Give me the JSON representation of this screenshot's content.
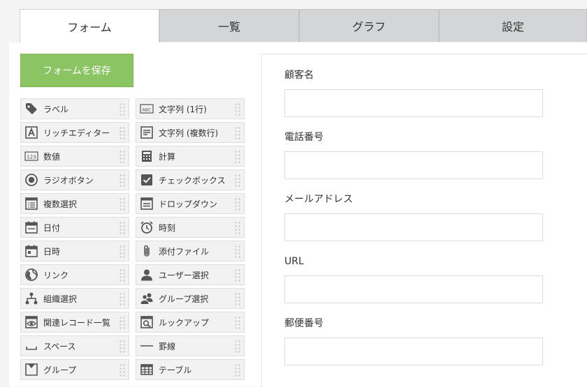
{
  "tabs": [
    {
      "label": "フォーム"
    },
    {
      "label": "一覧"
    },
    {
      "label": "グラフ"
    },
    {
      "label": "設定"
    }
  ],
  "save_button": {
    "label": "フォームを保存"
  },
  "palette": [
    {
      "label": "ラベル",
      "icon": "tag-icon"
    },
    {
      "label": "文字列 (1行)",
      "icon": "abc-text-icon"
    },
    {
      "label": "リッチエディター",
      "icon": "rich-editor-icon"
    },
    {
      "label": "文字列 (複数行)",
      "icon": "multiline-text-icon"
    },
    {
      "label": "数値",
      "icon": "number-123-icon"
    },
    {
      "label": "計算",
      "icon": "calculator-icon"
    },
    {
      "label": "ラジオボタン",
      "icon": "radio-button-icon"
    },
    {
      "label": "チェックボックス",
      "icon": "checkbox-icon"
    },
    {
      "label": "複数選択",
      "icon": "multi-select-list-icon"
    },
    {
      "label": "ドロップダウン",
      "icon": "dropdown-icon"
    },
    {
      "label": "日付",
      "icon": "calendar-icon"
    },
    {
      "label": "時刻",
      "icon": "alarm-clock-icon"
    },
    {
      "label": "日時",
      "icon": "calendar-datetime-icon"
    },
    {
      "label": "添付ファイル",
      "icon": "paperclip-icon"
    },
    {
      "label": "リンク",
      "icon": "globe-icon"
    },
    {
      "label": "ユーザー選択",
      "icon": "user-icon"
    },
    {
      "label": "組織選択",
      "icon": "org-chart-icon"
    },
    {
      "label": "グループ選択",
      "icon": "group-users-icon"
    },
    {
      "label": "関連レコード一覧",
      "icon": "related-records-eye-icon"
    },
    {
      "label": "ルックアップ",
      "icon": "lookup-magnifier-icon"
    },
    {
      "label": "スペース",
      "icon": "space-icon"
    },
    {
      "label": "罫線",
      "icon": "horizontal-rule-icon"
    },
    {
      "label": "グループ",
      "icon": "group-box-icon"
    },
    {
      "label": "テーブル",
      "icon": "table-icon"
    }
  ],
  "form_fields": [
    {
      "label": "顧客名",
      "value": ""
    },
    {
      "label": "電話番号",
      "value": ""
    },
    {
      "label": "メールアドレス",
      "value": ""
    },
    {
      "label": "URL",
      "value": ""
    },
    {
      "label": "郵便番号",
      "value": ""
    }
  ],
  "colors": {
    "save_button_bg": "#8bc462",
    "tab_inactive_bg": "#d4d5d6",
    "icon": "#555555"
  }
}
